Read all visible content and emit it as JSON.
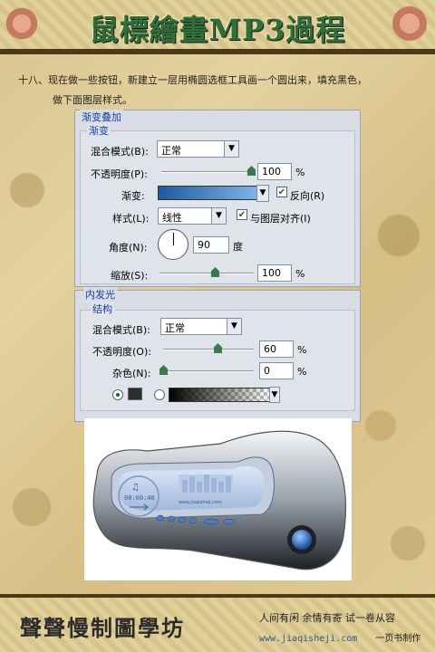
{
  "header": {
    "title": "鼠標繪畫MP3過程"
  },
  "instruction": {
    "line1": "十八、现在做一些按钮，新建立一层用椭圆选框工具画一个圆出来，填充黑色，",
    "line2": "做下面图层样式。"
  },
  "gradient_overlay": {
    "section_title": "渐变叠加",
    "group_title": "渐变",
    "blend_mode_label": "混合模式(B):",
    "blend_mode_value": "正常",
    "opacity_label": "不透明度(P):",
    "opacity_value": "100",
    "opacity_unit": "%",
    "opacity_level": 1.0,
    "gradient_label": "渐变:",
    "reverse_label": "反向(R)",
    "reverse_checked": true,
    "style_label": "样式(L):",
    "style_value": "线性",
    "align_label": "与图层对齐(I)",
    "align_checked": true,
    "angle_label": "角度(N):",
    "angle_value": "90",
    "angle_unit": "度",
    "scale_label": "缩放(S):",
    "scale_value": "100",
    "scale_unit": "%",
    "scale_level": 0.5
  },
  "inner_glow": {
    "section_title": "内发光",
    "group_title": "结构",
    "blend_mode_label": "混合模式(B):",
    "blend_mode_value": "正常",
    "opacity_label": "不透明度(O):",
    "opacity_value": "60",
    "opacity_unit": "%",
    "opacity_level": 0.6,
    "noise_label": "杂色(N):",
    "noise_value": "0",
    "noise_unit": "%",
    "noise_level": 0.0
  },
  "preview": {
    "screen_text": "www.jiaqisheji.com",
    "time_text": "00:00:40"
  },
  "footer": {
    "left_text": "聲聲慢制圖學坊",
    "tagline": "人间有闲  余情有寄  试一卷从容",
    "site": "www.jiaqisheji.com",
    "credit": "一页书制作"
  }
}
